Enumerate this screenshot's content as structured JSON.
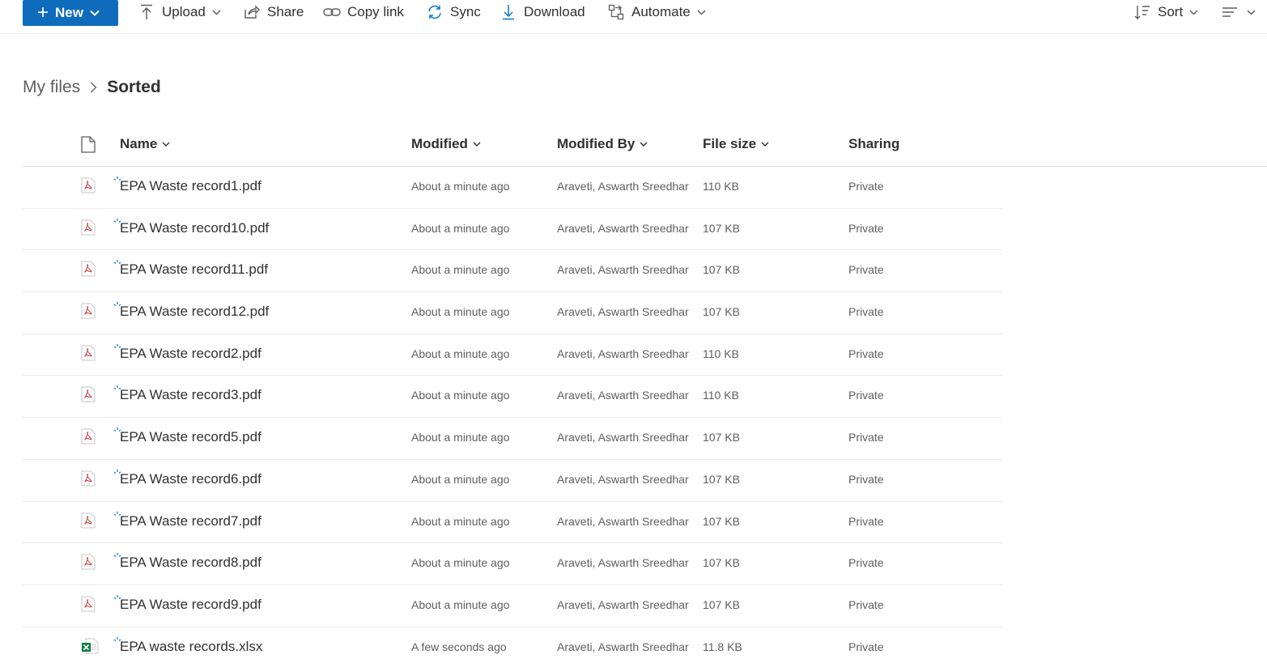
{
  "commandbar": {
    "new_label": "New",
    "upload_label": "Upload",
    "share_label": "Share",
    "copy_link_label": "Copy link",
    "sync_label": "Sync",
    "download_label": "Download",
    "automate_label": "Automate",
    "sort_label": "Sort"
  },
  "breadcrumb": {
    "root": "My files",
    "current": "Sorted"
  },
  "columns": {
    "name": "Name",
    "modified": "Modified",
    "modified_by": "Modified By",
    "file_size": "File size",
    "sharing": "Sharing"
  },
  "files": [
    {
      "name": "EPA Waste record1.pdf",
      "type": "pdf",
      "modified": "About a minute ago",
      "modified_by": "Araveti, Aswarth Sreedhar",
      "size": "110 KB",
      "sharing": "Private"
    },
    {
      "name": "EPA Waste record10.pdf",
      "type": "pdf",
      "modified": "About a minute ago",
      "modified_by": "Araveti, Aswarth Sreedhar",
      "size": "107 KB",
      "sharing": "Private"
    },
    {
      "name": "EPA Waste record11.pdf",
      "type": "pdf",
      "modified": "About a minute ago",
      "modified_by": "Araveti, Aswarth Sreedhar",
      "size": "107 KB",
      "sharing": "Private"
    },
    {
      "name": "EPA Waste record12.pdf",
      "type": "pdf",
      "modified": "About a minute ago",
      "modified_by": "Araveti, Aswarth Sreedhar",
      "size": "107 KB",
      "sharing": "Private"
    },
    {
      "name": "EPA Waste record2.pdf",
      "type": "pdf",
      "modified": "About a minute ago",
      "modified_by": "Araveti, Aswarth Sreedhar",
      "size": "110 KB",
      "sharing": "Private"
    },
    {
      "name": "EPA Waste record3.pdf",
      "type": "pdf",
      "modified": "About a minute ago",
      "modified_by": "Araveti, Aswarth Sreedhar",
      "size": "110 KB",
      "sharing": "Private"
    },
    {
      "name": "EPA Waste record5.pdf",
      "type": "pdf",
      "modified": "About a minute ago",
      "modified_by": "Araveti, Aswarth Sreedhar",
      "size": "107 KB",
      "sharing": "Private"
    },
    {
      "name": "EPA Waste record6.pdf",
      "type": "pdf",
      "modified": "About a minute ago",
      "modified_by": "Araveti, Aswarth Sreedhar",
      "size": "107 KB",
      "sharing": "Private"
    },
    {
      "name": "EPA Waste record7.pdf",
      "type": "pdf",
      "modified": "About a minute ago",
      "modified_by": "Araveti, Aswarth Sreedhar",
      "size": "107 KB",
      "sharing": "Private"
    },
    {
      "name": "EPA Waste record8.pdf",
      "type": "pdf",
      "modified": "About a minute ago",
      "modified_by": "Araveti, Aswarth Sreedhar",
      "size": "107 KB",
      "sharing": "Private"
    },
    {
      "name": "EPA Waste record9.pdf",
      "type": "pdf",
      "modified": "About a minute ago",
      "modified_by": "Araveti, Aswarth Sreedhar",
      "size": "107 KB",
      "sharing": "Private"
    },
    {
      "name": "EPA waste records.xlsx",
      "type": "xlsx",
      "modified": "A few seconds ago",
      "modified_by": "Araveti, Aswarth Sreedhar",
      "size": "11.8 KB",
      "sharing": "Private"
    }
  ],
  "colors": {
    "accent": "#0f6cbd",
    "pdf_icon": "#d13438",
    "excel_icon": "#107c41",
    "new_marker": "#0078d4"
  }
}
